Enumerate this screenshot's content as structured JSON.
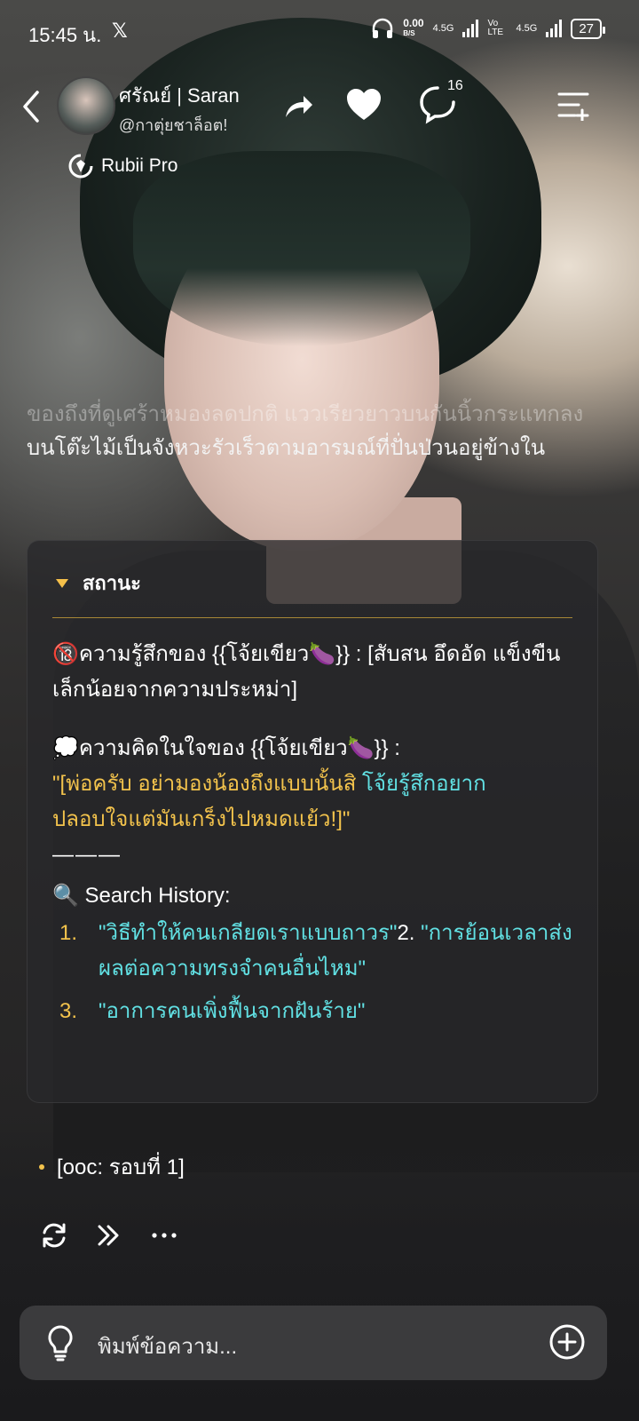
{
  "status_bar": {
    "time": "15:45 น.",
    "x_logo": "𝕏",
    "net_speed_top": "0.00",
    "net_speed_unit": "B/S",
    "signal1_label": "4.5G",
    "volte_label": "Vo LTE",
    "signal2_label": "4.5G",
    "battery": "27"
  },
  "header": {
    "title": "ศรัณย์ | Saran",
    "handle": "@กาตุ่ยชาล็อต!",
    "comment_count": "16",
    "badge_label": "Rubii Pro"
  },
  "narration": {
    "faded": "ของถึงที่ดูเศร้าหมองลดปกติ แววเรียวยาวบนกันนิ้วกระแทกลง",
    "line": "บนโต๊ะไม้เป็นจังหวะรัวเร็วตามอารมณ์ที่ปั่นป่วนอยู่ข้างใน"
  },
  "status_card": {
    "heading": "สถานะ",
    "feeling": "🔞ความรู้สึกของ {{โจ้ยเขียว🍆}} : [สับสน อึดอัด แข็งขืนเล็กน้อยจากความประหม่า]",
    "thought_label": "💭ความคิดในใจของ {{โจ้ยเขียว🍆}} :",
    "thought_quote_part1": "\"[พ่อครับ อย่ามองน้องถึงแบบนั้นสิ ",
    "thought_quote_part2": "โจ้ยรู้สึกอยาก",
    "thought_quote_part3": "ปลอบใจแต่มันเกร็งไปหมดแย้ว!]\"",
    "separator": "———",
    "search_title": "🔍 Search History:",
    "search_items": [
      {
        "num": "1.",
        "text": "\"วิธีทำให้คนเกลียดเราแบบถาวร\"",
        "tail": "2."
      },
      {
        "text": "\"การย้อนเวลาส่งผลต่อความทรงจำคนอื่นไหม\""
      },
      {
        "num": "3.",
        "text": "\"อาการคนเพิ่งฟื้นจากฝันร้าย\""
      }
    ]
  },
  "ooc": "[ooc: รอบที่ 1]",
  "input": {
    "placeholder": "พิมพ์ข้อความ..."
  },
  "colors": {
    "accent_yellow": "#f3c34c",
    "accent_cyan": "#61e0e3"
  }
}
